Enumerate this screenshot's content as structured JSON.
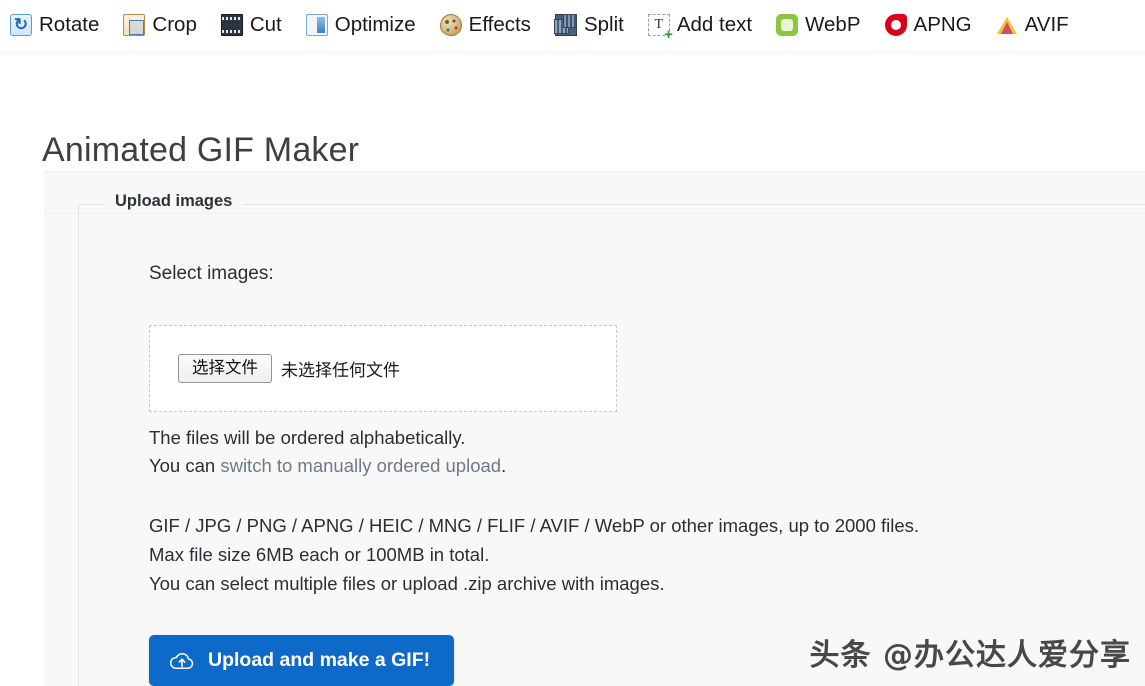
{
  "toolbar": {
    "items": [
      {
        "label": "Rotate",
        "icon": "rotate-icon"
      },
      {
        "label": "Crop",
        "icon": "crop-icon"
      },
      {
        "label": "Cut",
        "icon": "cut-icon"
      },
      {
        "label": "Optimize",
        "icon": "optimize-icon"
      },
      {
        "label": "Effects",
        "icon": "effects-icon"
      },
      {
        "label": "Split",
        "icon": "split-icon"
      },
      {
        "label": "Add text",
        "icon": "add-text-icon"
      },
      {
        "label": "WebP",
        "icon": "webp-icon"
      },
      {
        "label": "APNG",
        "icon": "apng-icon"
      },
      {
        "label": "AVIF",
        "icon": "avif-icon"
      }
    ]
  },
  "page": {
    "title": "Animated GIF Maker"
  },
  "upload": {
    "legend": "Upload images",
    "select_label": "Select images:",
    "choose_file_button": "选择文件",
    "no_file_text": "未选择任何文件",
    "note_order": "The files will be ordered alphabetically.",
    "note_switch_prefix": "You can ",
    "note_switch_link": "switch to manually ordered upload",
    "note_switch_suffix": ".",
    "note_formats": "GIF / JPG / PNG / APNG / HEIC / MNG / FLIF / AVIF / WebP or other images, up to 2000 files.",
    "note_maxsize": "Max file size 6MB each or 100MB in total.",
    "note_multi": "You can select multiple files or upload .zip archive with images.",
    "submit_label": "Upload and make a GIF!",
    "submit_icon": "cloud-upload-icon",
    "accent_color": "#0d6ac8"
  },
  "watermark": {
    "text": "头条 @办公达人爱分享"
  }
}
